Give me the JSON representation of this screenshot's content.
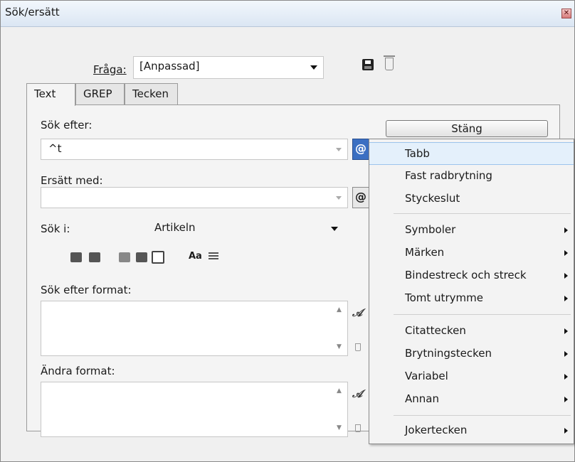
{
  "window": {
    "title": "Sök/ersätt"
  },
  "query": {
    "label": "Fråga:",
    "value": "[Anpassad]"
  },
  "tabs": [
    {
      "label": "Text"
    },
    {
      "label": "GREP"
    },
    {
      "label": "Tecken"
    }
  ],
  "find": {
    "label": "Sök efter:",
    "value": "^t"
  },
  "replace": {
    "label": "Ersätt med:",
    "value": ""
  },
  "close_button": {
    "label": "Stäng"
  },
  "search_in": {
    "label": "Sök i:",
    "value": "Artikeln"
  },
  "case_label": "Aa",
  "find_format": {
    "label": "Sök efter format:"
  },
  "change_format": {
    "label": "Ändra format:"
  },
  "special_char_menu": {
    "groups": [
      [
        "Tabb",
        "Fast radbrytning",
        "Styckeslut"
      ],
      [
        "Symboler",
        "Märken",
        "Bindestreck och streck",
        "Tomt utrymme"
      ],
      [
        "Citattecken",
        "Brytningstecken",
        "Variabel",
        "Annan"
      ],
      [
        "Jokertecken"
      ]
    ],
    "highlighted": "Tabb"
  },
  "colors": {
    "highlight": "#e4f0fb",
    "accent": "#3b6fc2"
  }
}
